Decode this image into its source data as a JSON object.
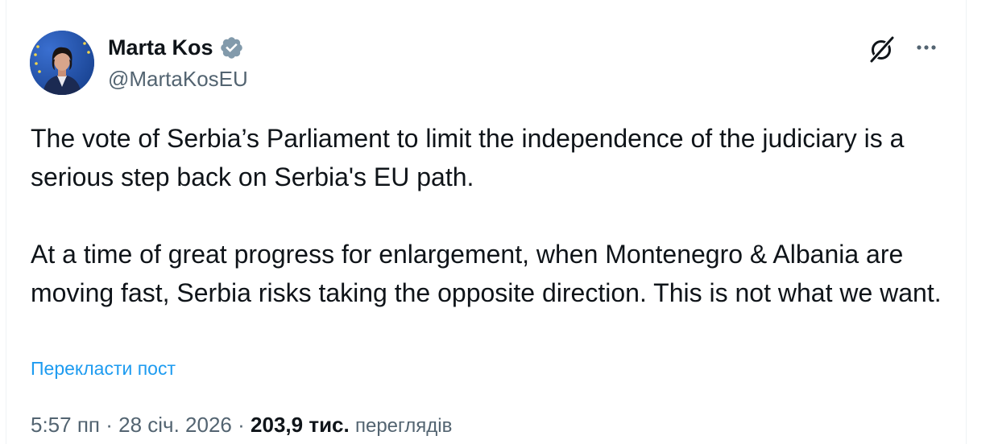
{
  "author": {
    "name": "Marta Kos",
    "handle": "@MartaKosEU",
    "verified": true
  },
  "icons": {
    "verified": "verified-badge-icon",
    "grok": "grok-icon",
    "more": "more-options-icon"
  },
  "tweet": {
    "paragraphs": [
      "The vote of Serbia’s Parliament to limit the independence of the judiciary is a serious step back on Serbia's EU path.",
      "At a time of great progress for enlargement, when Montenegro & Albania are moving fast, Serbia risks taking the opposite direction. This is not what we want."
    ],
    "translate_label": "Перекласти пост"
  },
  "meta": {
    "time": "5:57 пп",
    "separator": "·",
    "date": "28 січ. 2026",
    "views_count": "203,9 тис.",
    "views_label": "переглядів"
  },
  "colors": {
    "text_primary": "#0f1419",
    "text_secondary": "#536471",
    "link": "#1d9bf0",
    "verified_badge": "#829aab"
  }
}
